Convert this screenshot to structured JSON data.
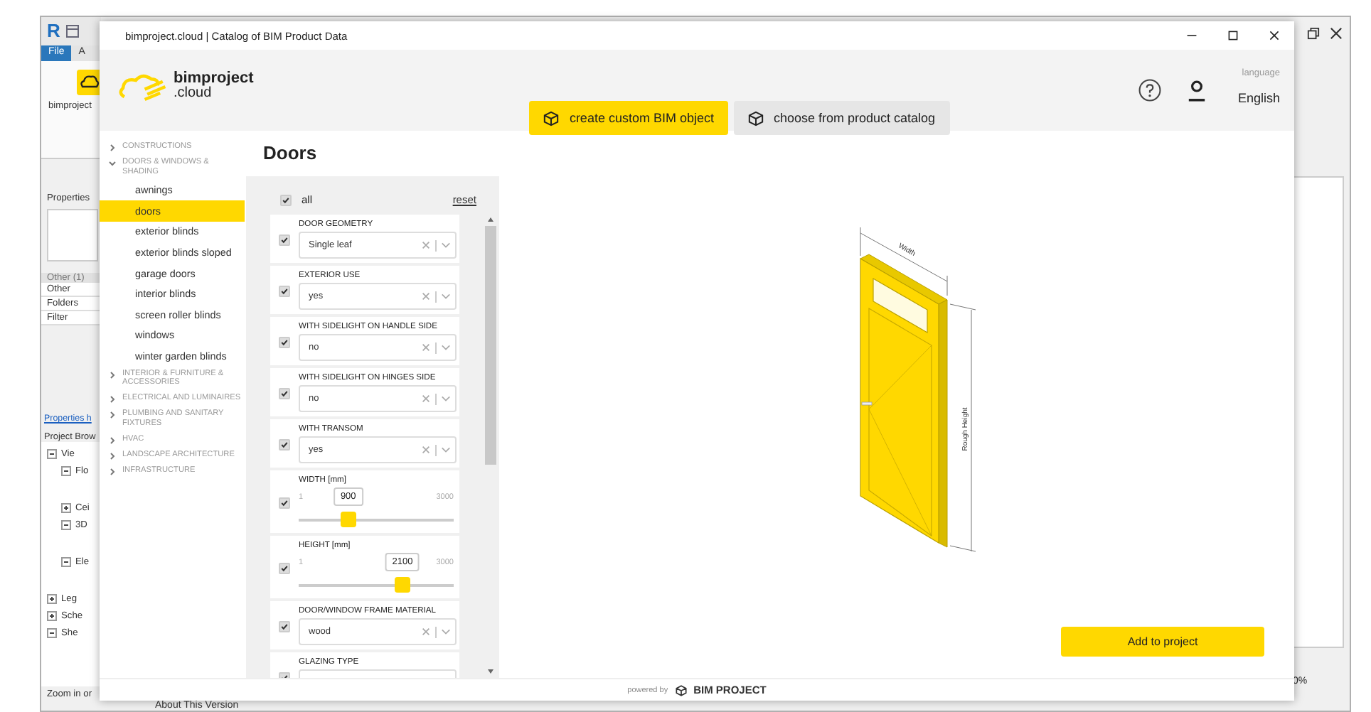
{
  "background_app": {
    "logo": "R",
    "tabs": [
      {
        "label": "File",
        "selected": true
      },
      {
        "label": "A",
        "selected": false
      }
    ],
    "addin_label": "bimproject",
    "properties_title": "Properties",
    "category": "Other (1)",
    "properties": [
      "Other",
      "Folders",
      "Filter"
    ],
    "help_link": "Properties h",
    "browser_title": "Project Brow",
    "tree": [
      {
        "label": "Vie",
        "expanded": true,
        "children": [
          {
            "label": "Flo",
            "expanded": true
          },
          {
            "label": "Cei",
            "expanded": false
          },
          {
            "label": "3D",
            "expanded": true
          },
          {
            "label": "Ele",
            "expanded": true
          }
        ]
      },
      {
        "label": "Leg",
        "expanded": false
      },
      {
        "label": "Sche",
        "expanded": false
      },
      {
        "label": "She",
        "expanded": true
      }
    ],
    "status": "Zoom in or",
    "zoom_level": "0%",
    "bottom_text": "About This Version"
  },
  "window": {
    "title": "bimproject.cloud | Catalog of BIM Product Data"
  },
  "header": {
    "logo": [
      "bimproject",
      ".cloud"
    ],
    "actions": [
      {
        "label": "create custom BIM object",
        "selected": true
      },
      {
        "label": "choose from product catalog",
        "selected": false
      }
    ],
    "language_label": "language",
    "language": "English"
  },
  "sidebar": [
    {
      "label": "CONSTRUCTIONS",
      "expanded": false
    },
    {
      "label": "DOORS & WINDOWS & SHADING",
      "expanded": true,
      "children": [
        {
          "label": "awnings",
          "selected": false
        },
        {
          "label": "doors",
          "selected": true
        },
        {
          "label": "exterior blinds",
          "selected": false
        },
        {
          "label": "exterior blinds sloped",
          "selected": false
        },
        {
          "label": "garage doors",
          "selected": false
        },
        {
          "label": "interior blinds",
          "selected": false
        },
        {
          "label": "screen roller blinds",
          "selected": false
        },
        {
          "label": "windows",
          "selected": false
        },
        {
          "label": "winter garden blinds",
          "selected": false
        }
      ]
    },
    {
      "label": "INTERIOR & FURNITURE & ACCESSORIES",
      "expanded": false
    },
    {
      "label": "ELECTRICAL AND LUMINAIRES",
      "expanded": false
    },
    {
      "label": "PLUMBING AND SANITARY FIXTURES",
      "expanded": false
    },
    {
      "label": "HVAC",
      "expanded": false
    },
    {
      "label": "LANDSCAPE ARCHITECTURE",
      "expanded": false
    },
    {
      "label": "INFRASTRUCTURE",
      "expanded": false
    }
  ],
  "page_title": "Doors",
  "filters": {
    "all": {
      "label": "all",
      "checked": true
    },
    "reset": "reset",
    "items": [
      {
        "kind": "select",
        "label": "DOOR GEOMETRY",
        "value": "Single leaf",
        "checked": true
      },
      {
        "kind": "select",
        "label": "EXTERIOR USE",
        "value": "yes",
        "checked": true
      },
      {
        "kind": "select",
        "label": "WITH SIDELIGHT ON HANDLE SIDE",
        "value": "no",
        "checked": true
      },
      {
        "kind": "select",
        "label": "WITH SIDELIGHT ON HINGES SIDE",
        "value": "no",
        "checked": true
      },
      {
        "kind": "select",
        "label": "WITH TRANSOM",
        "value": "yes",
        "checked": true
      },
      {
        "kind": "range",
        "label": "WIDTH [mm]",
        "min": "1",
        "max": "3000",
        "value": "900",
        "level": 0.32,
        "checked": true
      },
      {
        "kind": "range",
        "label": "HEIGHT [mm]",
        "min": "1",
        "max": "3000",
        "value": "2100",
        "level": 0.67,
        "checked": true
      },
      {
        "kind": "select",
        "label": "DOOR/WINDOW FRAME MATERIAL",
        "value": "wood",
        "checked": true
      },
      {
        "kind": "select",
        "label": "GLAZING TYPE",
        "checked": true
      }
    ]
  },
  "drawing": {
    "width_label": "Width",
    "height_label": "Rough Height"
  },
  "add_button": "Add to project",
  "footer": {
    "prefix": "powered by",
    "brand": "BIM PROJECT"
  }
}
